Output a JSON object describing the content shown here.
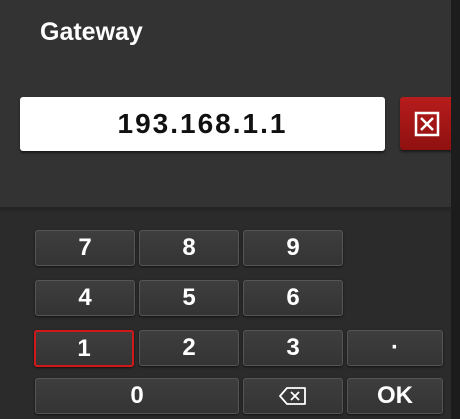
{
  "dialog": {
    "title": "Gateway",
    "value": "193.168.1.1"
  },
  "clear_button": {
    "icon": "clear-box-icon",
    "color": "#b71c1c"
  },
  "keypad": {
    "keys": {
      "k7": "7",
      "k8": "8",
      "k9": "9",
      "k4": "4",
      "k5": "5",
      "k6": "6",
      "k1": "1",
      "k2": "2",
      "k3": "3",
      "dot": "·",
      "k0": "0",
      "backspace_icon": "backspace-icon",
      "ok": "OK"
    },
    "focused_key": "1",
    "focus_color": "#d01818"
  }
}
